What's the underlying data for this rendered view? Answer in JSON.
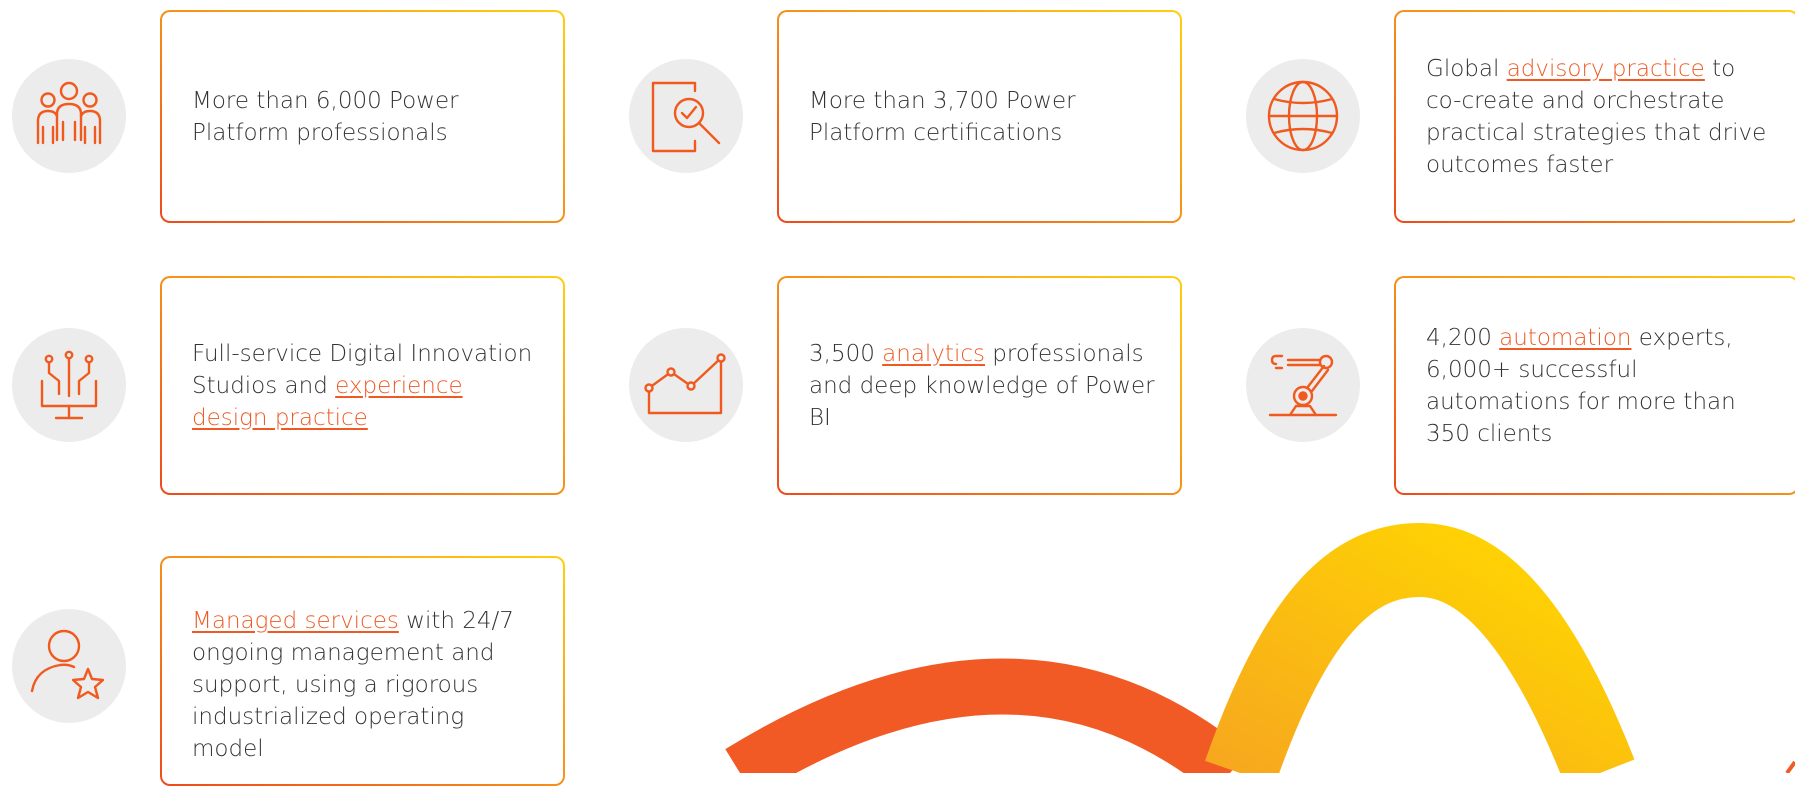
{
  "colors": {
    "accent": "#ee5a24",
    "icon": "#f05a1e",
    "icon_bg": "#ececec",
    "border_start": "#ee4a1c",
    "border_end": "#ffcf10",
    "text": "#333333",
    "arc_orange": "#f15a24",
    "arc_yellow": "#ffd000"
  },
  "cards": [
    {
      "icon": "people-group-icon",
      "before": "More than 6,000 Power Platform professionals",
      "link": "",
      "after": ""
    },
    {
      "icon": "document-check-magnifier-icon",
      "before": "More than 3,700 Power Platform certifications",
      "link": "",
      "after": ""
    },
    {
      "icon": "globe-icon",
      "before": "Global ",
      "link": "advisory practice",
      "after": " to co-create and orchestrate practical strategies that drive outcomes faster"
    },
    {
      "icon": "circuit-monitor-icon",
      "before": "Full-service Digital Innovation Studios and ",
      "link": "experience design practice",
      "after": ""
    },
    {
      "icon": "line-chart-icon",
      "before": "3,500 ",
      "link": "analytics",
      "after": " professionals and deep knowledge of Power BI"
    },
    {
      "icon": "robotic-arm-icon",
      "before": "4,200 ",
      "link": "automation",
      "after": " experts, 6,000+ successful automations for more than 350 clients"
    },
    {
      "icon": "person-star-icon",
      "before": "",
      "link": "Managed services",
      "after": " with 24/7 ongoing management and support, using a rigorous industrialized operating model"
    }
  ]
}
